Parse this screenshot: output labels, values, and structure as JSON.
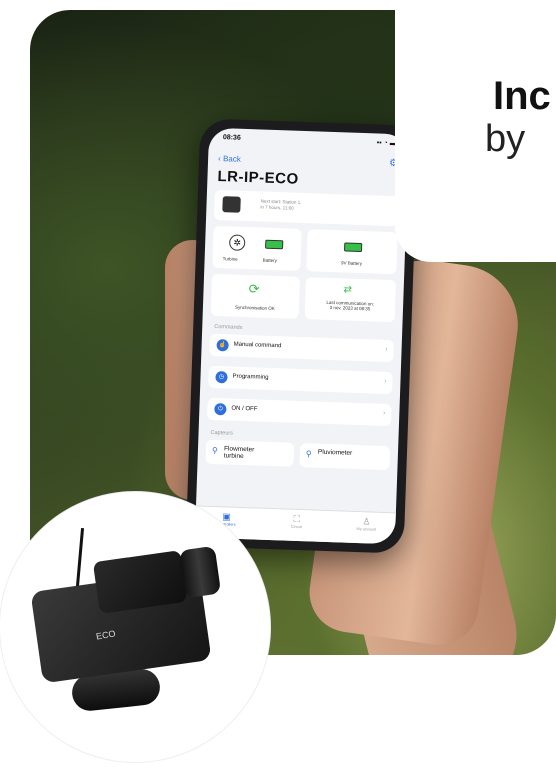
{
  "headline": {
    "line1": "Inc",
    "line2": "by"
  },
  "phone": {
    "time": "08:36",
    "back": "Back",
    "device_name": "LR-IP-ECO",
    "next_start": "Next start: Station 1,\nin 7 hours, 11:00",
    "status_cards": {
      "turbine": "Turbine",
      "battery": "Battery",
      "battery_9v": "9V Battery",
      "sync": "Synchronisation OK",
      "last_comm": "Last communication on:\n3 nov. 2023 at 08:35"
    },
    "commands_header": "Commands",
    "commands": [
      {
        "label": "Manual command"
      },
      {
        "label": "Programming"
      },
      {
        "label": "ON / OFF"
      }
    ],
    "sensors_header": "Capteurs",
    "sensors": [
      {
        "label": "Flowmeter\nturbine"
      },
      {
        "label": "Pluviometer"
      }
    ],
    "tabs": [
      {
        "label": "Controllers"
      },
      {
        "label": "Circuit"
      },
      {
        "label": "My account"
      }
    ]
  },
  "device": {
    "label": "ECO"
  },
  "colors": {
    "accent": "#2f6fdc",
    "ok": "#36c04a"
  }
}
